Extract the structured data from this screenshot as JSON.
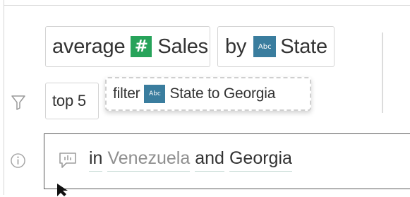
{
  "query_pills": [
    {
      "prefix": "average",
      "field_type_icon": "number-icon",
      "field_type_glyph": "#",
      "field": "Sales"
    },
    {
      "prefix": "by",
      "field_type_icon": "string-icon",
      "field_type_glyph": "Abc",
      "field": "State"
    }
  ],
  "filter_row": {
    "top_label": "top 5",
    "suggestion": {
      "prefix": "filter",
      "field_type_icon": "string-icon",
      "field_type_glyph": "Abc",
      "text": "State to Georgia"
    }
  },
  "input": {
    "words": [
      {
        "text": "in",
        "tone": "dark"
      },
      {
        "text": "Venezuela",
        "tone": "light"
      },
      {
        "text": "and",
        "tone": "dark"
      },
      {
        "text": "Georgia",
        "tone": "dark"
      }
    ]
  },
  "colors": {
    "number_field": "#27a35a",
    "string_field": "#3a7d9e",
    "underline": "#bfd7cf",
    "input_border": "#5a5a5a"
  }
}
